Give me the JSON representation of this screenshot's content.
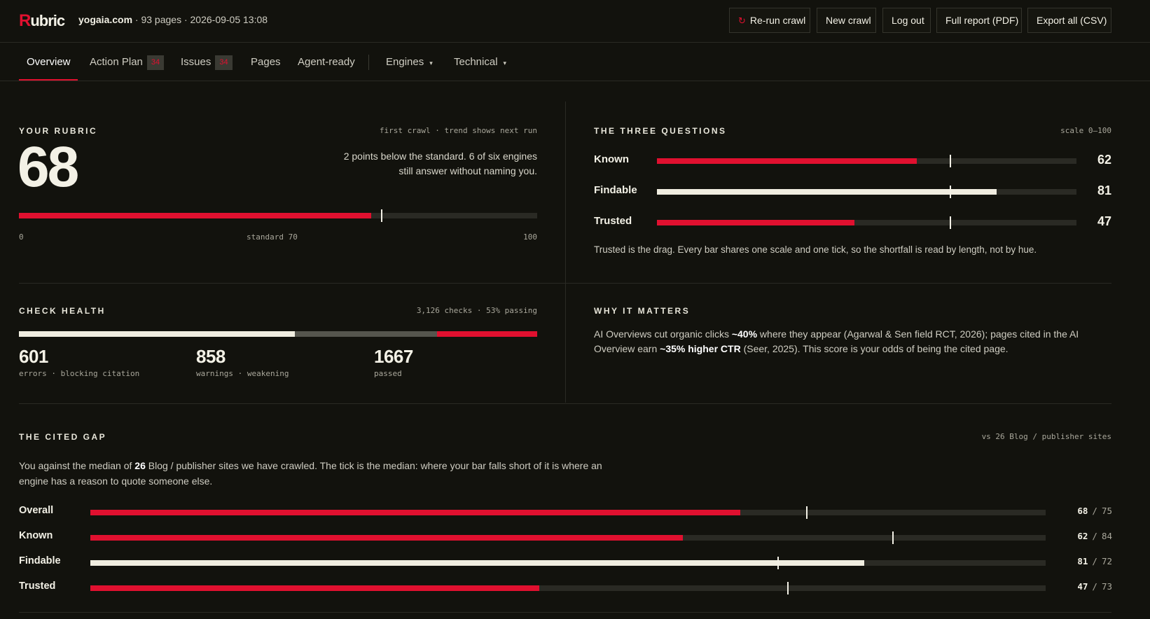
{
  "header": {
    "logo_r": "R",
    "logo_rest": "ubric",
    "domain": "yogaia.com",
    "meta": " · 93 pages · 2026-09-05 13:08",
    "buttons": {
      "rerun": "Re-run crawl",
      "new_crawl": "New crawl",
      "logout": "Log out",
      "full_report": "Full report (PDF)",
      "export_all": "Export all (CSV)"
    }
  },
  "nav": {
    "overview": "Overview",
    "action_plan": "Action Plan",
    "action_plan_count": "34",
    "issues": "Issues",
    "issues_count": "34",
    "pages": "Pages",
    "agent_ready": "Agent-ready",
    "engines": "Engines",
    "technical": "Technical"
  },
  "rubric": {
    "label": "YOUR RUBRIC",
    "note": "first crawl · trend shows next run",
    "score": "68",
    "score_value": 68,
    "standard_value": 70,
    "summary": "2 points below the standard. 6 of six engines still answer without naming you.",
    "axis_min": "0",
    "axis_mid": "standard 70",
    "axis_max": "100"
  },
  "three_questions": {
    "label": "THE THREE QUESTIONS",
    "note": "scale 0–100",
    "standard_value": 70,
    "items": [
      {
        "name": "Known",
        "value": 62,
        "display": "62",
        "color": "#e0102f"
      },
      {
        "name": "Findable",
        "value": 81,
        "display": "81",
        "color": "#f0ede0"
      },
      {
        "name": "Trusted",
        "value": 47,
        "display": "47",
        "color": "#e0102f"
      }
    ],
    "caption": "Trusted is the drag. Every bar shares one scale and one tick, so the shortfall is read by length, not by hue."
  },
  "check_health": {
    "label": "CHECK HEALTH",
    "note": "3,126 checks · 53% passing",
    "passed_share": 0.533,
    "warnings_share": 0.274,
    "errors_share": 0.193,
    "errors": {
      "value": "601",
      "caption": "errors · blocking citation"
    },
    "warnings": {
      "value": "858",
      "caption": "warnings · weakening"
    },
    "passed": {
      "value": "1667",
      "caption": "passed"
    },
    "colors": {
      "passed": "#f0ede0",
      "warnings": "#55554d",
      "errors": "#e0102f"
    }
  },
  "why_it_matters": {
    "label": "WHY IT MATTERS",
    "t1": "AI Overviews cut organic clicks ",
    "b1": "~40%",
    "t2": " where they appear (Agarwal & Sen field RCT, 2026); pages cited in the AI Overview earn ",
    "b2": "~35% higher CTR",
    "t3": " (Seer, 2025). This score is your odds of being the cited page."
  },
  "cited_gap": {
    "label": "THE CITED GAP",
    "note": "vs 26 Blog / publisher sites",
    "d1": "You against the median of ",
    "d_bold": "26",
    "d2": " Blog / publisher sites we have crawled. The tick is the median: where your bar falls short of it is where an engine has a reason to quote someone else.",
    "separator": "/",
    "rows": [
      {
        "name": "Overall",
        "you": 68,
        "median": 75,
        "you_display": "68",
        "median_display": "75",
        "color": "#e0102f"
      },
      {
        "name": "Known",
        "you": 62,
        "median": 84,
        "you_display": "62",
        "median_display": "84",
        "color": "#e0102f"
      },
      {
        "name": "Findable",
        "you": 81,
        "median": 72,
        "you_display": "81",
        "median_display": "72",
        "color": "#f0ede0"
      },
      {
        "name": "Trusted",
        "you": 47,
        "median": 73,
        "you_display": "47",
        "median_display": "73",
        "color": "#e0102f"
      }
    ]
  }
}
